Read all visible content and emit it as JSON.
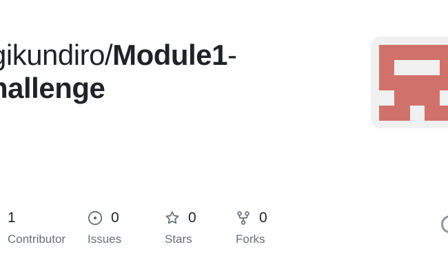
{
  "repo": {
    "owner_fragment": "gikundiro/",
    "name_line1": "Module1",
    "name_dash": "-",
    "name_line2": "hallenge"
  },
  "identicon": {
    "color": "#d0726a",
    "background": "#f0f0f0"
  },
  "stats": {
    "contributors": {
      "count": "1",
      "label": "Contributor"
    },
    "issues": {
      "count": "0",
      "label": "Issues",
      "icon": "issue-opened-icon"
    },
    "stars": {
      "count": "0",
      "label": "Stars",
      "icon": "star-icon"
    },
    "forks": {
      "count": "0",
      "label": "Forks",
      "icon": "repo-forked-icon"
    }
  }
}
